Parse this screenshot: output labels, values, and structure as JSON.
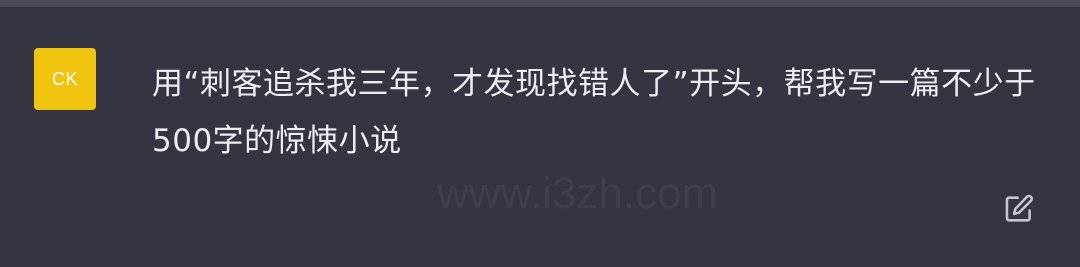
{
  "message": {
    "avatar_initials": "CK",
    "avatar_color": "#f1c40f",
    "text": "用“刺客追杀我三年，才发现找错人了”开头，帮我写一篇不少于500字的惊悚小说"
  },
  "watermark": {
    "text": "www.i3zh.com"
  },
  "actions": {
    "edit_icon": "edit-icon"
  }
}
